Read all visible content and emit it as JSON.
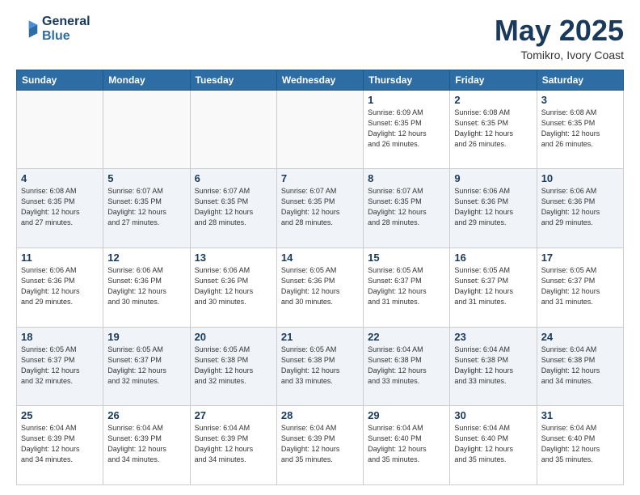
{
  "header": {
    "logo_line1": "General",
    "logo_line2": "Blue",
    "title": "May 2025",
    "subtitle": "Tomikro, Ivory Coast"
  },
  "weekdays": [
    "Sunday",
    "Monday",
    "Tuesday",
    "Wednesday",
    "Thursday",
    "Friday",
    "Saturday"
  ],
  "weeks": [
    [
      {
        "day": "",
        "info": ""
      },
      {
        "day": "",
        "info": ""
      },
      {
        "day": "",
        "info": ""
      },
      {
        "day": "",
        "info": ""
      },
      {
        "day": "1",
        "info": "Sunrise: 6:09 AM\nSunset: 6:35 PM\nDaylight: 12 hours\nand 26 minutes."
      },
      {
        "day": "2",
        "info": "Sunrise: 6:08 AM\nSunset: 6:35 PM\nDaylight: 12 hours\nand 26 minutes."
      },
      {
        "day": "3",
        "info": "Sunrise: 6:08 AM\nSunset: 6:35 PM\nDaylight: 12 hours\nand 26 minutes."
      }
    ],
    [
      {
        "day": "4",
        "info": "Sunrise: 6:08 AM\nSunset: 6:35 PM\nDaylight: 12 hours\nand 27 minutes."
      },
      {
        "day": "5",
        "info": "Sunrise: 6:07 AM\nSunset: 6:35 PM\nDaylight: 12 hours\nand 27 minutes."
      },
      {
        "day": "6",
        "info": "Sunrise: 6:07 AM\nSunset: 6:35 PM\nDaylight: 12 hours\nand 28 minutes."
      },
      {
        "day": "7",
        "info": "Sunrise: 6:07 AM\nSunset: 6:35 PM\nDaylight: 12 hours\nand 28 minutes."
      },
      {
        "day": "8",
        "info": "Sunrise: 6:07 AM\nSunset: 6:35 PM\nDaylight: 12 hours\nand 28 minutes."
      },
      {
        "day": "9",
        "info": "Sunrise: 6:06 AM\nSunset: 6:36 PM\nDaylight: 12 hours\nand 29 minutes."
      },
      {
        "day": "10",
        "info": "Sunrise: 6:06 AM\nSunset: 6:36 PM\nDaylight: 12 hours\nand 29 minutes."
      }
    ],
    [
      {
        "day": "11",
        "info": "Sunrise: 6:06 AM\nSunset: 6:36 PM\nDaylight: 12 hours\nand 29 minutes."
      },
      {
        "day": "12",
        "info": "Sunrise: 6:06 AM\nSunset: 6:36 PM\nDaylight: 12 hours\nand 30 minutes."
      },
      {
        "day": "13",
        "info": "Sunrise: 6:06 AM\nSunset: 6:36 PM\nDaylight: 12 hours\nand 30 minutes."
      },
      {
        "day": "14",
        "info": "Sunrise: 6:05 AM\nSunset: 6:36 PM\nDaylight: 12 hours\nand 30 minutes."
      },
      {
        "day": "15",
        "info": "Sunrise: 6:05 AM\nSunset: 6:37 PM\nDaylight: 12 hours\nand 31 minutes."
      },
      {
        "day": "16",
        "info": "Sunrise: 6:05 AM\nSunset: 6:37 PM\nDaylight: 12 hours\nand 31 minutes."
      },
      {
        "day": "17",
        "info": "Sunrise: 6:05 AM\nSunset: 6:37 PM\nDaylight: 12 hours\nand 31 minutes."
      }
    ],
    [
      {
        "day": "18",
        "info": "Sunrise: 6:05 AM\nSunset: 6:37 PM\nDaylight: 12 hours\nand 32 minutes."
      },
      {
        "day": "19",
        "info": "Sunrise: 6:05 AM\nSunset: 6:37 PM\nDaylight: 12 hours\nand 32 minutes."
      },
      {
        "day": "20",
        "info": "Sunrise: 6:05 AM\nSunset: 6:38 PM\nDaylight: 12 hours\nand 32 minutes."
      },
      {
        "day": "21",
        "info": "Sunrise: 6:05 AM\nSunset: 6:38 PM\nDaylight: 12 hours\nand 33 minutes."
      },
      {
        "day": "22",
        "info": "Sunrise: 6:04 AM\nSunset: 6:38 PM\nDaylight: 12 hours\nand 33 minutes."
      },
      {
        "day": "23",
        "info": "Sunrise: 6:04 AM\nSunset: 6:38 PM\nDaylight: 12 hours\nand 33 minutes."
      },
      {
        "day": "24",
        "info": "Sunrise: 6:04 AM\nSunset: 6:38 PM\nDaylight: 12 hours\nand 34 minutes."
      }
    ],
    [
      {
        "day": "25",
        "info": "Sunrise: 6:04 AM\nSunset: 6:39 PM\nDaylight: 12 hours\nand 34 minutes."
      },
      {
        "day": "26",
        "info": "Sunrise: 6:04 AM\nSunset: 6:39 PM\nDaylight: 12 hours\nand 34 minutes."
      },
      {
        "day": "27",
        "info": "Sunrise: 6:04 AM\nSunset: 6:39 PM\nDaylight: 12 hours\nand 34 minutes."
      },
      {
        "day": "28",
        "info": "Sunrise: 6:04 AM\nSunset: 6:39 PM\nDaylight: 12 hours\nand 35 minutes."
      },
      {
        "day": "29",
        "info": "Sunrise: 6:04 AM\nSunset: 6:40 PM\nDaylight: 12 hours\nand 35 minutes."
      },
      {
        "day": "30",
        "info": "Sunrise: 6:04 AM\nSunset: 6:40 PM\nDaylight: 12 hours\nand 35 minutes."
      },
      {
        "day": "31",
        "info": "Sunrise: 6:04 AM\nSunset: 6:40 PM\nDaylight: 12 hours\nand 35 minutes."
      }
    ]
  ]
}
